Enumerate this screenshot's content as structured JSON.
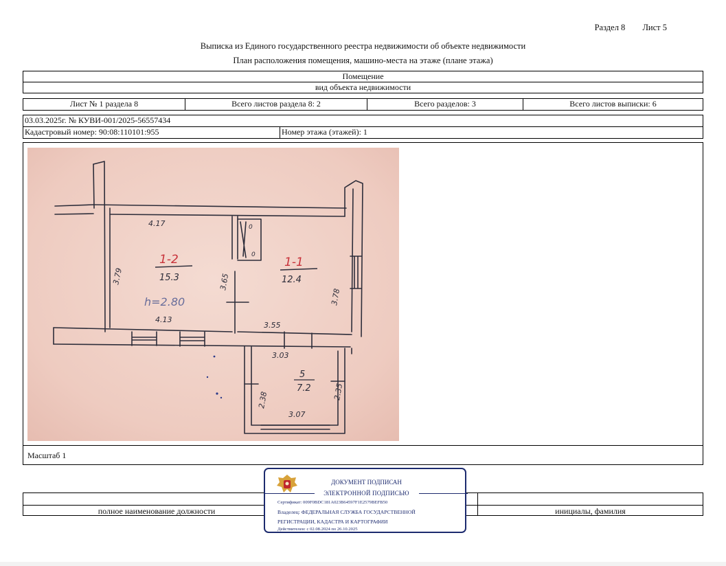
{
  "header": {
    "section": "Раздел 8",
    "sheet": "Лист 5",
    "title": "Выписка из Единого государственного реестра недвижимости об объекте недвижимости",
    "subtitle": "План расположения помещения, машино-места на этаже (плане этажа)"
  },
  "object": {
    "name": "Помещение",
    "type_label": "вид объекта недвижимости"
  },
  "sheets_row": {
    "sheet_of_section": "Лист № 1 раздела 8",
    "total_sheets_section": "Всего листов раздела 8: 2",
    "total_sections": "Всего разделов: 3",
    "total_sheets_extract": "Всего листов выписки: 6"
  },
  "doc_number": "03.03.2025г. № КУВИ-001/2025-56557434",
  "cadastral": "Кадастровый номер: 90:08:110101:955",
  "floor": "Номер этажа (этажей): 1",
  "plan": {
    "room1_id": "1-2",
    "room1_area": "15.3",
    "room2_id": "1-1",
    "room2_area": "12.4",
    "room3_id": "5",
    "room3_area": "7.2",
    "height": "h=2.80",
    "dims": {
      "d417": "4.17",
      "d413": "4.13",
      "d379": "3.79",
      "d365": "3.65",
      "d378": "3.78",
      "d355": "3.55",
      "d303": "3.03",
      "d307": "3.07",
      "d238": "2.38",
      "d235": "2.35"
    },
    "closet_mark": "0"
  },
  "scale": "Масштаб 1",
  "signature": {
    "position_label": "полное наименование должности",
    "name_label": "инициалы, фамилия"
  },
  "stamp": {
    "line1": "ДОКУМЕНТ ПОДПИСАН",
    "line2": "ЭЛЕКТРОННОЙ ПОДПИСЬЮ",
    "cert": "Сертификат: 009F0BDC181A023B64597F1E2579BEFB50",
    "owner": "Владелец: ФЕДЕРАЛЬНАЯ СЛУЖБА ГОСУДАРСТВЕННОЙ",
    "owner2": "РЕГИСТРАЦИИ, КАДАСТРА И КАРТОГРАФИИ",
    "valid": "Действителен: с 02.08.2024 по 26.10.2025"
  },
  "colors": {
    "paper_pink": "#f1d3c9",
    "ink_pencil": "#2d2d3a",
    "ink_red": "#c8323a",
    "stamp_blue": "#1c2a6e"
  }
}
